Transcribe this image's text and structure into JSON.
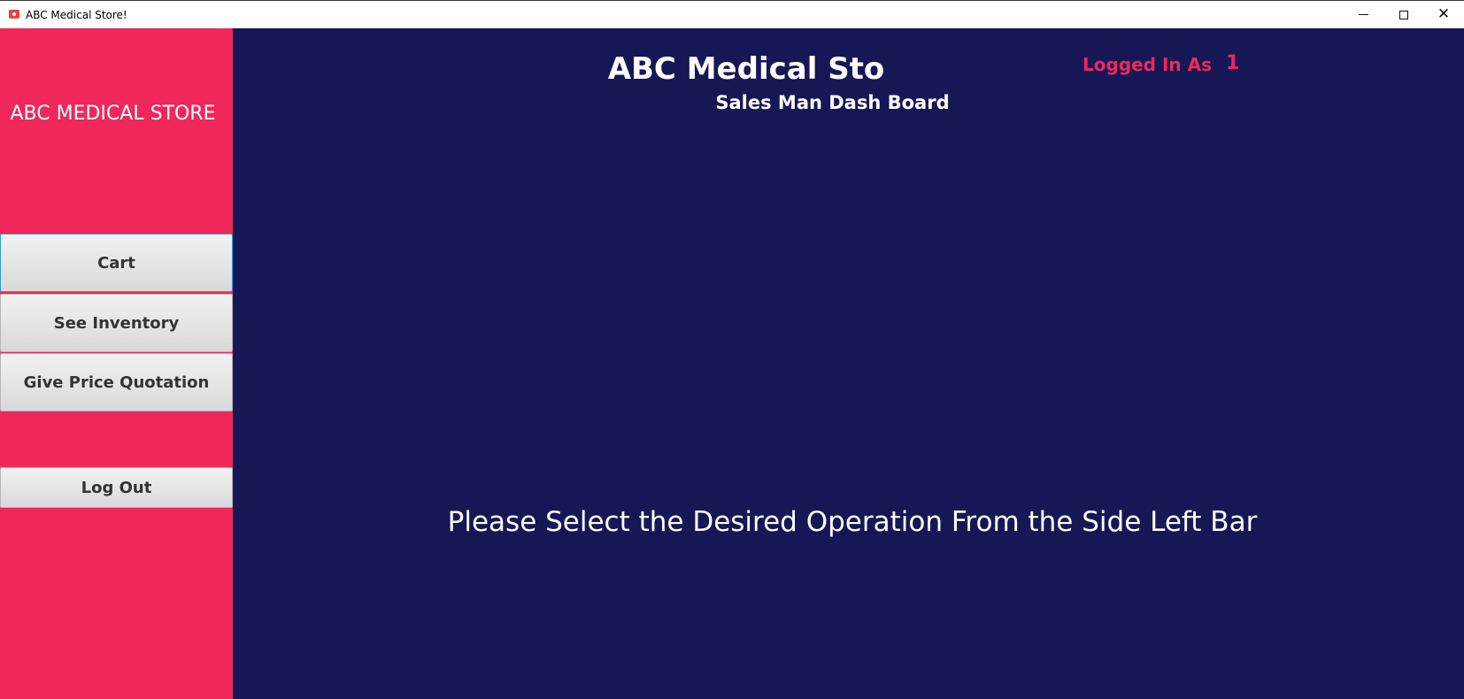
{
  "window": {
    "title": "ABC Medical Store!",
    "minimize_icon": "minimize-icon",
    "maximize_icon": "maximize-icon",
    "close_icon": "close-icon",
    "close_glyph": "✕"
  },
  "sidebar": {
    "brand": "ABC MEDICAL STORE",
    "buttons": {
      "cart": "Cart",
      "inventory": "See Inventory",
      "quotation": "Give Price Quotation",
      "logout": "Log Out"
    }
  },
  "header": {
    "title": "ABC Medical Sto",
    "subtitle": "Sales Man Dash Board",
    "logged_in_label": "Logged In As",
    "logged_in_value": "1"
  },
  "main": {
    "instruction": "Please Select the Desired Operation From the Side Left Bar"
  },
  "colors": {
    "sidebar_bg": "#ef275b",
    "main_bg": "#161855",
    "accent_text": "#ef275b",
    "button_text": "#333333"
  }
}
